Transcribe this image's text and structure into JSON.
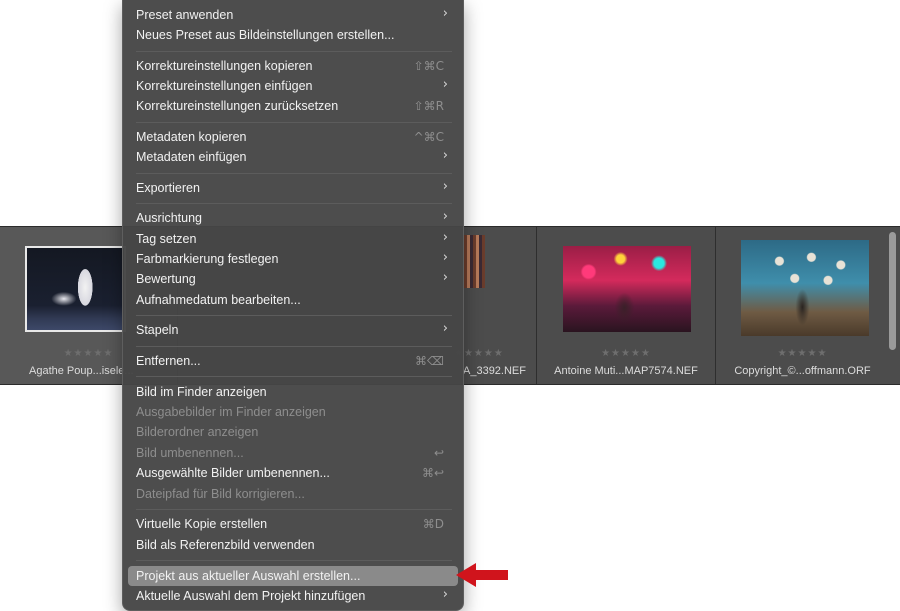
{
  "filmstrip": {
    "items": [
      {
        "filename": "Agathe Poup...isele...",
        "rating": "★★★★★"
      },
      {
        "filename": "A_3392.NEF",
        "rating": "★★★★★"
      },
      {
        "filename": "Antoine Muti...MAP7574.NEF",
        "rating": "★★★★★"
      },
      {
        "filename": "Copyright_©...offmann.ORF",
        "rating": "★★★★★"
      }
    ]
  },
  "menu": {
    "items": [
      {
        "label": "Preset anwenden",
        "shortcut": "",
        "submenu": "›"
      },
      {
        "label": "Neues Preset aus Bildeinstellungen erstellen...",
        "shortcut": "",
        "submenu": ""
      },
      {
        "label": "Korrektureinstellungen kopieren",
        "shortcut": "⇧⌘C",
        "submenu": ""
      },
      {
        "label": "Korrektureinstellungen einfügen",
        "shortcut": "",
        "submenu": "›"
      },
      {
        "label": "Korrektureinstellungen zurücksetzen",
        "shortcut": "⇧⌘R",
        "submenu": ""
      },
      {
        "label": "Metadaten kopieren",
        "shortcut": "^⌘C",
        "submenu": ""
      },
      {
        "label": "Metadaten einfügen",
        "shortcut": "",
        "submenu": "›"
      },
      {
        "label": "Exportieren",
        "shortcut": "",
        "submenu": "›"
      },
      {
        "label": "Ausrichtung",
        "shortcut": "",
        "submenu": "›"
      },
      {
        "label": "Tag setzen",
        "shortcut": "",
        "submenu": "›"
      },
      {
        "label": "Farbmarkierung festlegen",
        "shortcut": "",
        "submenu": "›"
      },
      {
        "label": "Bewertung",
        "shortcut": "",
        "submenu": "›"
      },
      {
        "label": "Aufnahmedatum bearbeiten...",
        "shortcut": "",
        "submenu": ""
      },
      {
        "label": "Stapeln",
        "shortcut": "",
        "submenu": "›"
      },
      {
        "label": "Entfernen...",
        "shortcut": "⌘⌫",
        "submenu": ""
      },
      {
        "label": "Bild im Finder anzeigen",
        "shortcut": "",
        "submenu": ""
      },
      {
        "label": "Ausgabebilder im Finder anzeigen",
        "shortcut": "",
        "submenu": ""
      },
      {
        "label": "Bilderordner anzeigen",
        "shortcut": "",
        "submenu": ""
      },
      {
        "label": "Bild umbenennen...",
        "shortcut": "↩",
        "submenu": ""
      },
      {
        "label": "Ausgewählte Bilder umbenennen...",
        "shortcut": "⌘↩",
        "submenu": ""
      },
      {
        "label": "Dateipfad für Bild korrigieren...",
        "shortcut": "",
        "submenu": ""
      },
      {
        "label": "Virtuelle Kopie erstellen",
        "shortcut": "⌘D",
        "submenu": ""
      },
      {
        "label": "Bild als Referenzbild verwenden",
        "shortcut": "",
        "submenu": ""
      },
      {
        "label": "Projekt aus aktueller Auswahl erstellen...",
        "shortcut": "",
        "submenu": ""
      },
      {
        "label": "Aktuelle Auswahl dem Projekt hinzufügen",
        "shortcut": "",
        "submenu": "›"
      }
    ]
  },
  "colors": {
    "menu_background": "#464646",
    "highlight": "#8a8a8a",
    "arrow": "#d0141c",
    "filmstrip_background": "#4c4c4c"
  }
}
